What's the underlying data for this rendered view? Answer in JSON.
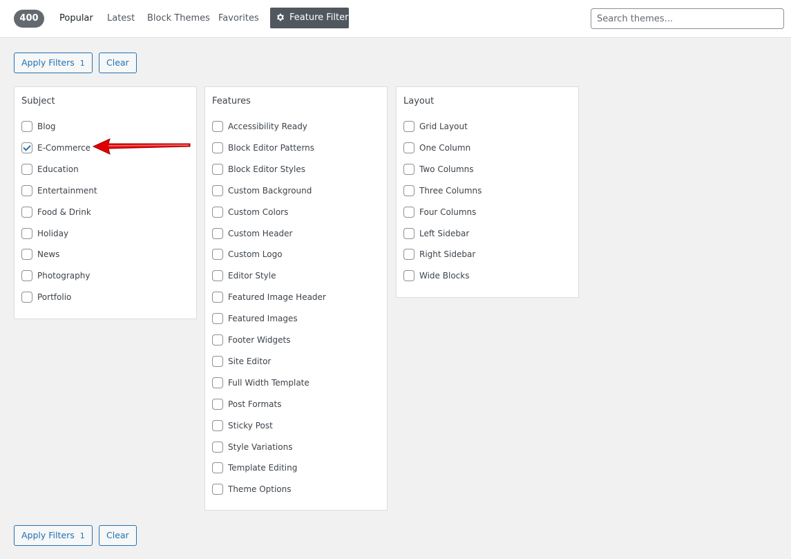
{
  "header": {
    "theme_count": "400",
    "tabs": [
      "Popular",
      "Latest",
      "Block Themes",
      "Favorites"
    ],
    "feature_filter_label": "Feature Filter",
    "search_placeholder": "Search themes..."
  },
  "filters": {
    "apply_label": "Apply Filters",
    "apply_count": "1",
    "clear_label": "Clear"
  },
  "groups": [
    {
      "title": "Subject",
      "options": [
        {
          "label": "Blog",
          "checked": false
        },
        {
          "label": "E-Commerce",
          "checked": true
        },
        {
          "label": "Education",
          "checked": false
        },
        {
          "label": "Entertainment",
          "checked": false
        },
        {
          "label": "Food & Drink",
          "checked": false
        },
        {
          "label": "Holiday",
          "checked": false
        },
        {
          "label": "News",
          "checked": false
        },
        {
          "label": "Photography",
          "checked": false
        },
        {
          "label": "Portfolio",
          "checked": false
        }
      ]
    },
    {
      "title": "Features",
      "options": [
        {
          "label": "Accessibility Ready",
          "checked": false
        },
        {
          "label": "Block Editor Patterns",
          "checked": false
        },
        {
          "label": "Block Editor Styles",
          "checked": false
        },
        {
          "label": "Custom Background",
          "checked": false
        },
        {
          "label": "Custom Colors",
          "checked": false
        },
        {
          "label": "Custom Header",
          "checked": false
        },
        {
          "label": "Custom Logo",
          "checked": false
        },
        {
          "label": "Editor Style",
          "checked": false
        },
        {
          "label": "Featured Image Header",
          "checked": false
        },
        {
          "label": "Featured Images",
          "checked": false
        },
        {
          "label": "Footer Widgets",
          "checked": false
        },
        {
          "label": "Site Editor",
          "checked": false
        },
        {
          "label": "Full Width Template",
          "checked": false
        },
        {
          "label": "Post Formats",
          "checked": false
        },
        {
          "label": "Sticky Post",
          "checked": false
        },
        {
          "label": "Style Variations",
          "checked": false
        },
        {
          "label": "Template Editing",
          "checked": false
        },
        {
          "label": "Theme Options",
          "checked": false
        }
      ]
    },
    {
      "title": "Layout",
      "options": [
        {
          "label": "Grid Layout",
          "checked": false
        },
        {
          "label": "One Column",
          "checked": false
        },
        {
          "label": "Two Columns",
          "checked": false
        },
        {
          "label": "Three Columns",
          "checked": false
        },
        {
          "label": "Four Columns",
          "checked": false
        },
        {
          "label": "Left Sidebar",
          "checked": false
        },
        {
          "label": "Right Sidebar",
          "checked": false
        },
        {
          "label": "Wide Blocks",
          "checked": false
        }
      ]
    }
  ],
  "icons": {
    "feature_filter": "gear-icon",
    "annotation": "red-arrow-icon"
  },
  "colors": {
    "accent": "#2271b1",
    "arrow": "#e00000",
    "count_bg": "#646970"
  }
}
